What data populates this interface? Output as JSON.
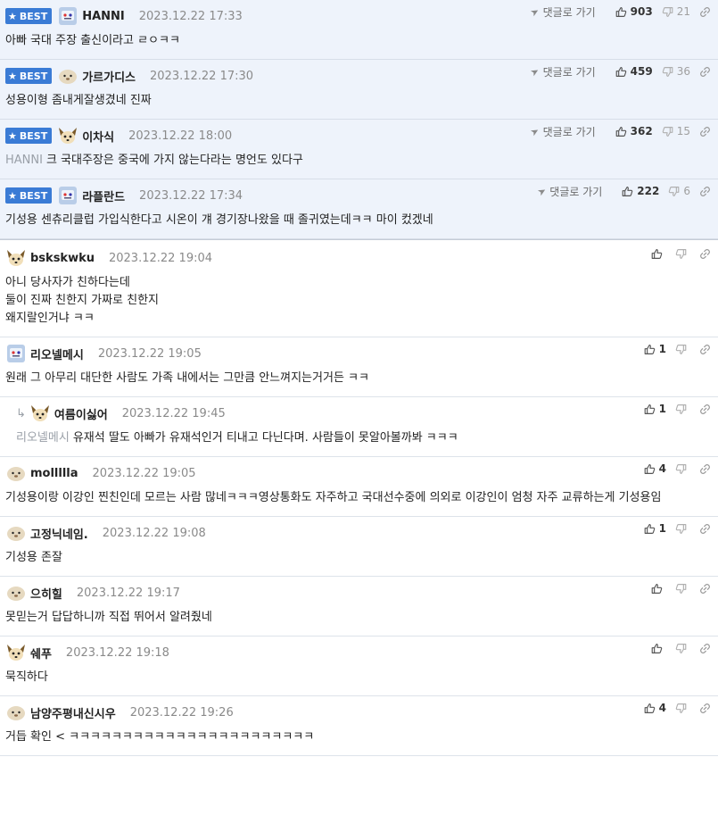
{
  "ui": {
    "best_label": "BEST",
    "goto_label": "댓글로 가기"
  },
  "comments": [
    {
      "best": true,
      "avatar": "ice-robot",
      "nick": "HANNI",
      "date": "2023.12.22 17:33",
      "up": "903",
      "down": "21",
      "text": "아빠 국대 주장 출신이라고 ㄹㅇㅋㅋ"
    },
    {
      "best": true,
      "avatar": "mole",
      "nick": "가르가디스",
      "date": "2023.12.22 17:30",
      "up": "459",
      "down": "36",
      "text": "성용이형 좀내게잘생겼네 진짜"
    },
    {
      "best": true,
      "avatar": "fox",
      "nick": "이차식",
      "date": "2023.12.22 18:00",
      "up": "362",
      "down": "15",
      "mention": "HANNI",
      "text": "크 국대주장은 중국에 가지 않는다라는 명언도 있다구"
    },
    {
      "best": true,
      "avatar": "ice-robot",
      "nick": "라플란드",
      "date": "2023.12.22 17:34",
      "up": "222",
      "down": "6",
      "text": "기성용 센츄리클럽 가입식한다고 시온이 걔 경기장나왔을 때 졸귀였는데ㅋㅋ 마이 컸겠네"
    },
    {
      "best": false,
      "avatar": "fox",
      "nick": "bskskwku",
      "date": "2023.12.22 19:04",
      "up": "",
      "down": "",
      "text": "아니 당사자가 친하다는데\n둘이 진짜 친한지 가짜로 친한지\n왜지랄인거냐 ㅋㅋ"
    },
    {
      "best": false,
      "avatar": "ice-robot",
      "nick": "리오넬메시",
      "date": "2023.12.22 19:05",
      "up": "1",
      "down": "",
      "text": "원래 그 아무리 대단한 사람도 가족 내에서는 그만큼 안느껴지는거거든 ㅋㅋ"
    },
    {
      "best": false,
      "reply": true,
      "avatar": "fox",
      "nick": "여름이싫어",
      "date": "2023.12.22 19:45",
      "up": "1",
      "down": "",
      "mention": "리오넬메시",
      "text": "유재석 딸도 아빠가 유재석인거 티내고 다닌다며. 사람들이 못알아볼까봐 ㅋㅋㅋ"
    },
    {
      "best": false,
      "avatar": "mole",
      "nick": "mollllla",
      "date": "2023.12.22 19:05",
      "up": "4",
      "down": "",
      "text": "기성용이랑 이강인 찐친인데 모르는 사람 많네ㅋㅋㅋ영상통화도 자주하고 국대선수중에 의외로 이강인이 엄청 자주 교류하는게 기성용임"
    },
    {
      "best": false,
      "avatar": "mole",
      "nick": "고정닉네임.",
      "date": "2023.12.22 19:08",
      "up": "1",
      "down": "",
      "text": "기성용 존잘"
    },
    {
      "best": false,
      "avatar": "mole",
      "nick": "으히힐",
      "date": "2023.12.22 19:17",
      "up": "",
      "down": "",
      "text": "못믿는거 답답하니까 직접 뛰어서 알려줬네"
    },
    {
      "best": false,
      "avatar": "fox",
      "nick": "쉐푸",
      "date": "2023.12.22 19:18",
      "up": "",
      "down": "",
      "text": "묵직하다"
    },
    {
      "best": false,
      "avatar": "mole",
      "nick": "남양주평내신시우",
      "date": "2023.12.22 19:26",
      "up": "4",
      "down": "",
      "text": "거듭 확인 < ㅋㅋㅋㅋㅋㅋㅋㅋㅋㅋㅋㅋㅋㅋㅋㅋㅋㅋㅋㅋㅋㅋㅋ"
    }
  ]
}
